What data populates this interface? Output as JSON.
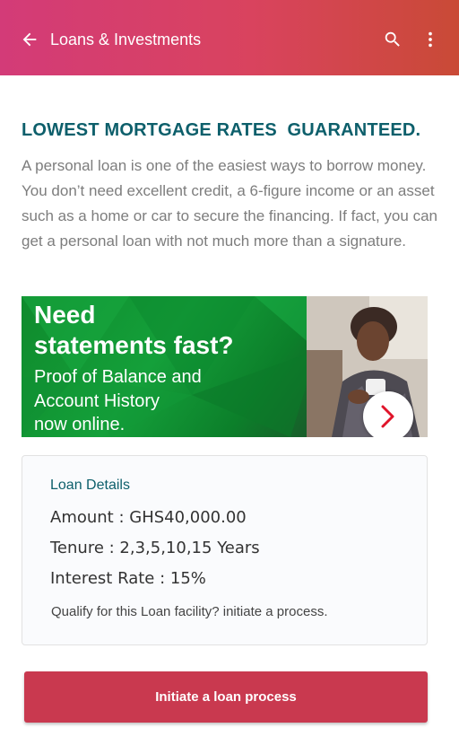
{
  "appbar": {
    "title": "Loans & Investments",
    "back_icon": "arrow-back-icon",
    "search_icon": "search-icon",
    "more_icon": "more-vert-icon"
  },
  "promo": {
    "headline": "LOWEST MORTGAGE RATES  GUARANTEED.",
    "body": "A personal loan is one of the easiest ways to borrow money. You don’t need excellent credit, a 6-figure income or an asset such as a home or car to secure the financing. If fact, you can get a personal loan with not much more than a signature."
  },
  "banner": {
    "line1": "Need",
    "line2": "statements fast?",
    "line3": "Proof of Balance and",
    "line4": "Account History",
    "line5": "now online.",
    "next_icon": "chevron-right-icon"
  },
  "loan_details": {
    "title": "Loan Details",
    "amount": "Amount : GHS40,000.00",
    "tenure": "Tenure : 2,3,5,10,15 Years",
    "interest": "Interest Rate : 15%",
    "note": "Qualify for this Loan facility? initiate a process."
  },
  "actions": {
    "initiate_label": "Initiate a loan process"
  },
  "colors": {
    "appbar_start": "#d33b78",
    "appbar_end": "#c94a36",
    "accent_text": "#0d5f6b",
    "button": "#c9394f",
    "banner_green": "#14a03a"
  }
}
